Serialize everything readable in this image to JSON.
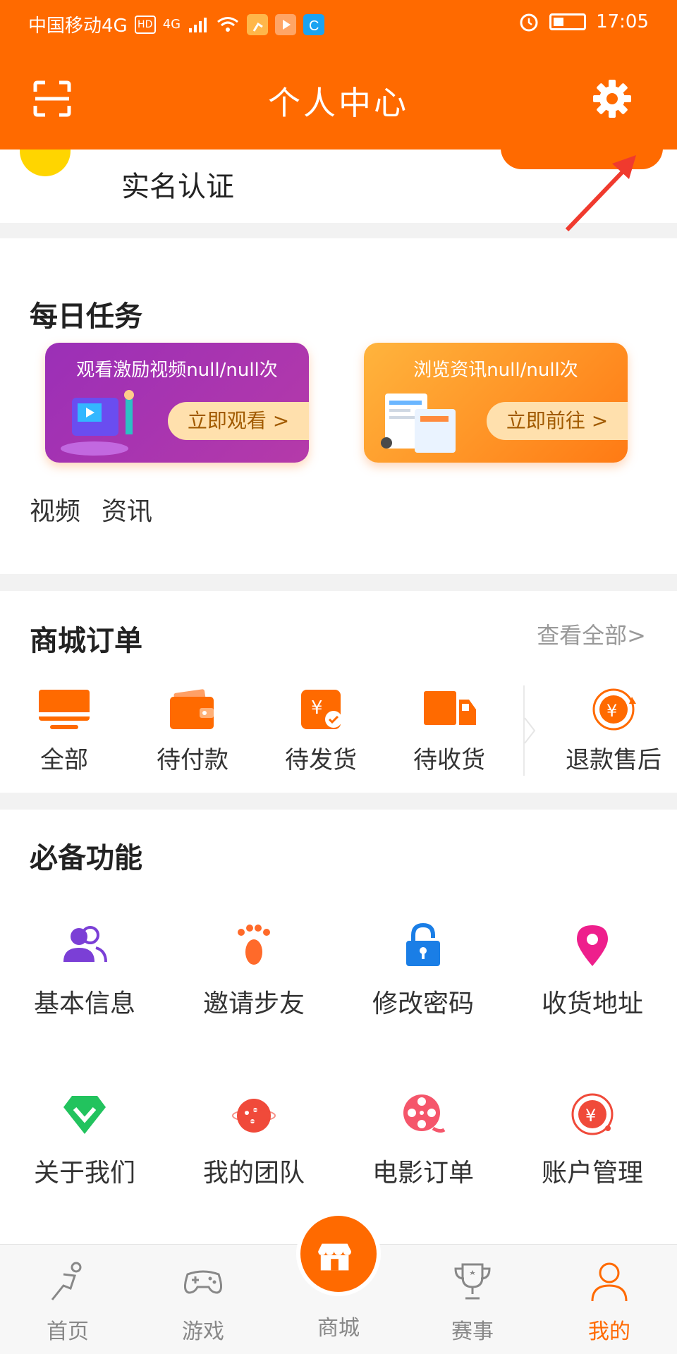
{
  "status_bar": {
    "carrier": "中国移动4G",
    "badge_hd": "HD",
    "signal": "4G",
    "time": "17:05"
  },
  "header": {
    "title": "个人中心"
  },
  "verify": {
    "label": "实名认证"
  },
  "daily_tasks": {
    "title": "每日任务",
    "cards": [
      {
        "title": "观看激励视频null/null次",
        "button": "立即观看 >"
      },
      {
        "title": "浏览资讯null/null次",
        "button": "立即前往 >"
      }
    ],
    "tabs": [
      "视频",
      "资讯"
    ]
  },
  "orders": {
    "title": "商城订单",
    "view_all": "查看全部>",
    "items": [
      "全部",
      "待付款",
      "待发货",
      "待收货",
      "退款售后"
    ]
  },
  "features": {
    "title": "必备功能",
    "items": [
      "基本信息",
      "邀请步友",
      "修改密码",
      "收货地址",
      "关于我们",
      "我的团队",
      "电影订单",
      "账户管理"
    ]
  },
  "bottom_nav": {
    "items": [
      "首页",
      "游戏",
      "商城",
      "赛事",
      "我的"
    ]
  },
  "colors": {
    "brand": "#ff6a00",
    "purple": "#7b3fd6",
    "green": "#22c35e",
    "blue": "#1a7ee6",
    "pink": "#ee1f8c",
    "red": "#f04a3a"
  }
}
